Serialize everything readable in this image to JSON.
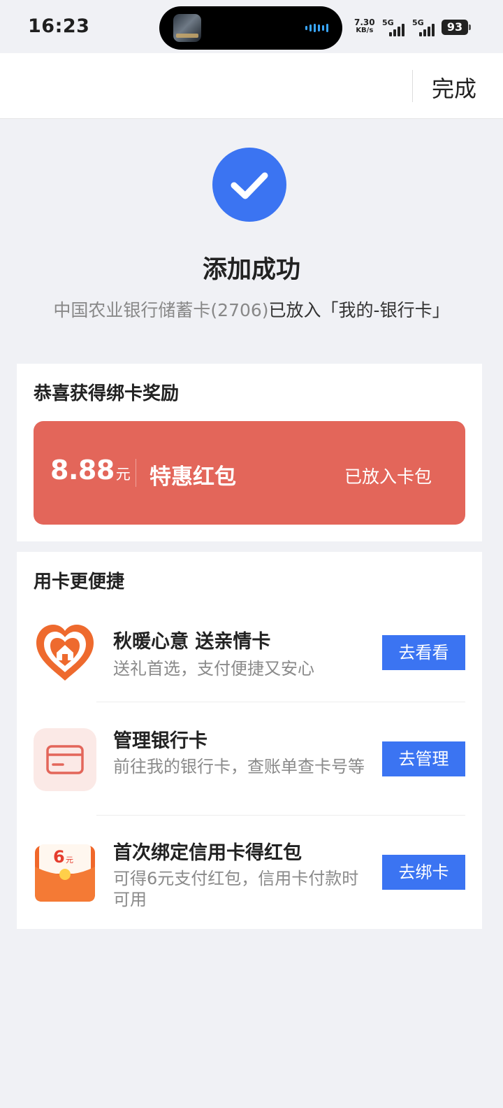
{
  "status_bar": {
    "time": "16:23",
    "net_speed_value": "7.30",
    "net_speed_unit": "KB/s",
    "sim1_label": "5G",
    "sim2_label": "5G",
    "battery": "93"
  },
  "nav": {
    "done_label": "完成"
  },
  "success": {
    "title": "添加成功",
    "desc_bank": "中国农业银行储蓄卡(2706)",
    "desc_placed": "已放入「我的-银行卡」"
  },
  "reward": {
    "title": "恭喜获得绑卡奖励",
    "amount": "8.88",
    "unit": "元",
    "name": "特惠红包",
    "status": "已放入卡包",
    "color": "#e3665a"
  },
  "services": {
    "title": "用卡更便捷",
    "items": [
      {
        "title": "秋暖心意 送亲情卡",
        "desc": "送礼首选，支付便捷又安心",
        "button": "去看看",
        "icon": "heart-home-icon"
      },
      {
        "title": "管理银行卡",
        "desc": "前往我的银行卡，查账单查卡号等",
        "button": "去管理",
        "icon": "bank-card-icon"
      },
      {
        "title": "首次绑定信用卡得红包",
        "desc": "可得6元支付红包，信用卡付款时可用",
        "button": "去绑卡",
        "icon": "red-packet-icon",
        "icon_amount": "6",
        "icon_unit": "元"
      }
    ]
  },
  "colors": {
    "accent": "#3b74f2",
    "background": "#f0f1f5"
  }
}
